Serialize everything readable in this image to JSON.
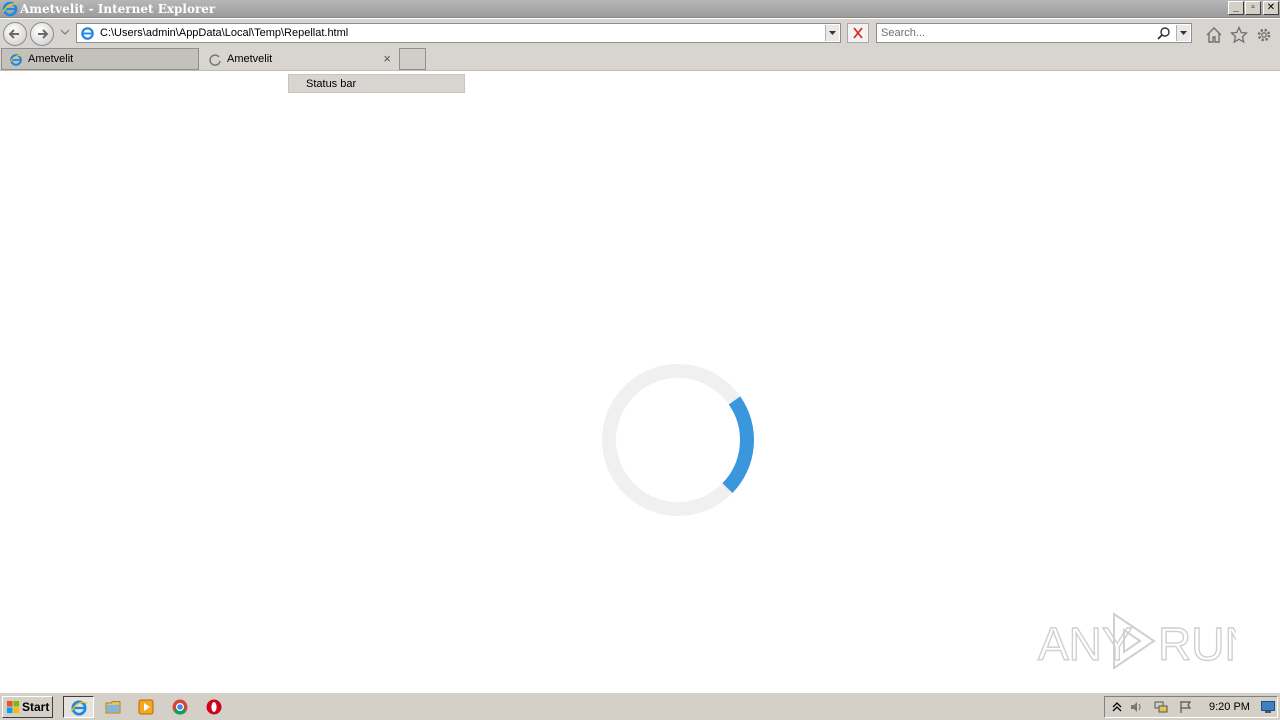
{
  "window": {
    "title": "Ametvelit - Internet Explorer",
    "controls": {
      "minimize": "_",
      "maximize": "▫",
      "close": "✕"
    }
  },
  "address_bar": {
    "url": "C:\\Users\\admin\\AppData\\Local\\Temp\\Repellat.html"
  },
  "search": {
    "placeholder": "Search..."
  },
  "tabs": [
    {
      "label": "Ametvelit",
      "icon": "ie-icon",
      "active": true
    },
    {
      "label": "Ametvelit",
      "icon": "loading-icon",
      "active": false,
      "close": "×"
    }
  ],
  "context_menu": {
    "items": [
      {
        "label": "Status bar"
      }
    ]
  },
  "page": {
    "spinner": {
      "arc_fraction": 0.22,
      "color": "#3a96dd",
      "track_color": "#f0f0f0"
    }
  },
  "taskbar": {
    "start_label": "Start",
    "pinned": [
      "ie-icon",
      "folder-icon",
      "media-player-icon",
      "chrome-icon",
      "opera-icon"
    ],
    "clock": "9:20 PM"
  },
  "watermark": {
    "text": "ANY RUN"
  },
  "colors": {
    "chrome_bg": "#d8d5d0",
    "accent": "#3a96dd"
  }
}
